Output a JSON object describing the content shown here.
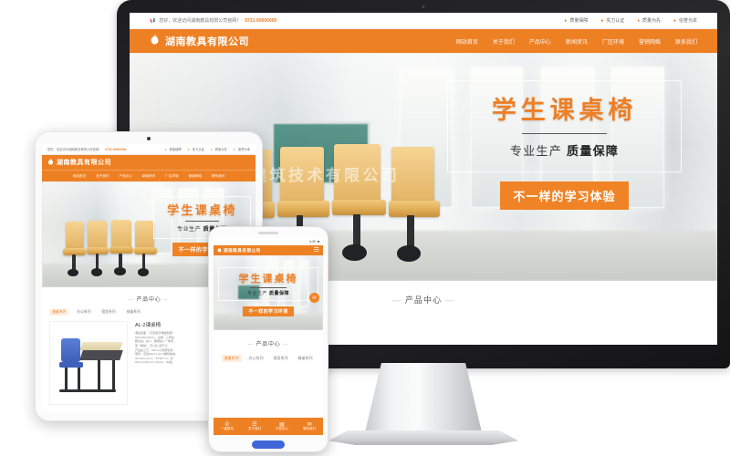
{
  "site": {
    "topbar": {
      "welcome_icon": "megaphone-icon",
      "welcome_text": "您好，欢迎访问湖南教具有限公司官网！",
      "phone": "0731-00000000",
      "features": [
        {
          "icon": "shield-icon",
          "label": "质量保障"
        },
        {
          "icon": "medal-icon",
          "label": "实力认证"
        },
        {
          "icon": "diamond-icon",
          "label": "质量为先"
        },
        {
          "icon": "trophy-icon",
          "label": "信誉为本"
        }
      ]
    },
    "brand": {
      "logo_icon": "flame-logo-icon",
      "name": "湖南教具有限公司"
    },
    "nav": [
      {
        "label": "网站首页"
      },
      {
        "label": "关于我们"
      },
      {
        "label": "产品中心"
      },
      {
        "label": "新闻资讯"
      },
      {
        "label": "厂区环境"
      },
      {
        "label": "营销网络"
      },
      {
        "label": "联系我们"
      }
    ],
    "hero": {
      "headline": "学生课桌椅",
      "subline_a": "专业生产",
      "subline_b": "质量保障",
      "cta_desktop": "不一样的学习体验",
      "cta_mobile": "不一样的学习环境",
      "watermark": "沙米拓普建筑技术有限公司"
    },
    "products": {
      "title": "产品中心",
      "dash_left": "—",
      "dash_right": "—",
      "categories": [
        {
          "label": "课桌系列",
          "active": true
        },
        {
          "label": "办公系列",
          "active": false
        },
        {
          "label": "宿舍系列",
          "active": false
        },
        {
          "label": "餐桌系列",
          "active": false
        }
      ],
      "item": {
        "name": "AL-2课桌椅",
        "spec_lines": [
          "课桌桌面：（高密度纤维板耐磨）",
          "600×450×18mm，边缘：三聚氰",
          "胺封边；桌斗：塑钢桌斗一体成",
          "型（规格）：高×宽×深尺寸；",
          "产品加工艺：63mm公称钢管架，",
          "钢管：直径Φ22×1.2mm塑粉静电；",
          "30×60×1.2mm，25*50*1.2，椅",
          "20mm×40mm×1.20mm，30座。"
        ]
      }
    }
  },
  "devices": {
    "monitor": {
      "name": "desktop-monitor"
    },
    "tablet": {
      "name": "tablet-device"
    },
    "phone": {
      "name": "mobile-phone"
    }
  },
  "mobile": {
    "tabbar": [
      {
        "icon": "phone-icon",
        "glyph": "✆",
        "label": "一键拨号"
      },
      {
        "icon": "user-icon",
        "glyph": "☰",
        "label": "关于我们"
      },
      {
        "icon": "product-icon",
        "glyph": "▤",
        "label": "产品中心"
      },
      {
        "icon": "contact-icon",
        "glyph": "✉",
        "label": "联系我们"
      }
    ],
    "status_time": "4:30"
  },
  "colors": {
    "brand_orange": "#ee8024",
    "accent_orange": "#ef8326",
    "text_dark": "#3a3a3a",
    "bezel_black": "#1d1d1f"
  }
}
